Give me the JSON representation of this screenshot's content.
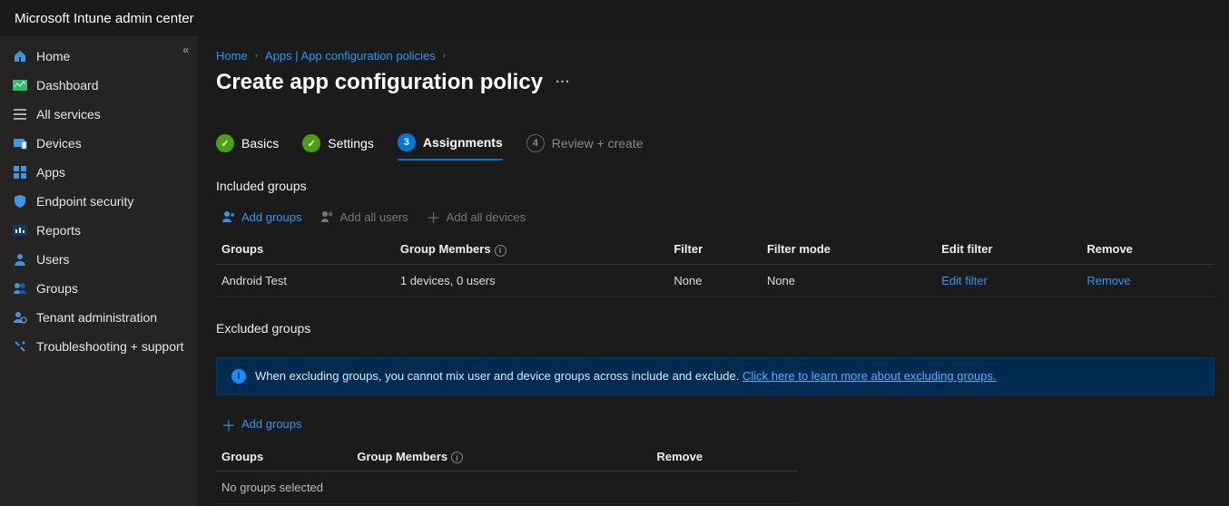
{
  "header": {
    "product": "Microsoft Intune admin center"
  },
  "sidebar": {
    "items": [
      {
        "label": "Home"
      },
      {
        "label": "Dashboard"
      },
      {
        "label": "All services"
      },
      {
        "label": "Devices"
      },
      {
        "label": "Apps"
      },
      {
        "label": "Endpoint security"
      },
      {
        "label": "Reports"
      },
      {
        "label": "Users"
      },
      {
        "label": "Groups"
      },
      {
        "label": "Tenant administration"
      },
      {
        "label": "Troubleshooting + support"
      }
    ]
  },
  "breadcrumb": {
    "home": "Home",
    "apps": "Apps | App configuration policies"
  },
  "page": {
    "title": "Create app configuration policy",
    "more": "···"
  },
  "wizard": {
    "s1": "Basics",
    "s2": "Settings",
    "s3": "Assignments",
    "s3_num": "3",
    "s4": "Review + create",
    "s4_num": "4"
  },
  "included": {
    "heading": "Included groups",
    "add_groups": "Add groups",
    "add_all_users": "Add all users",
    "add_all_devices": "Add all devices",
    "columns": {
      "groups": "Groups",
      "members": "Group Members",
      "filter": "Filter",
      "filter_mode": "Filter mode",
      "edit_filter": "Edit filter",
      "remove": "Remove"
    },
    "row": {
      "name": "Android Test",
      "members": "1 devices, 0 users",
      "filter": "None",
      "filter_mode": "None",
      "edit_filter": "Edit filter",
      "remove": "Remove"
    }
  },
  "excluded": {
    "heading": "Excluded groups",
    "info_text": "When excluding groups, you cannot mix user and device groups across include and exclude.",
    "info_link": "Click here to learn more about excluding groups.",
    "add_groups": "Add groups",
    "columns": {
      "groups": "Groups",
      "members": "Group Members",
      "remove": "Remove"
    },
    "empty": "No groups selected"
  }
}
